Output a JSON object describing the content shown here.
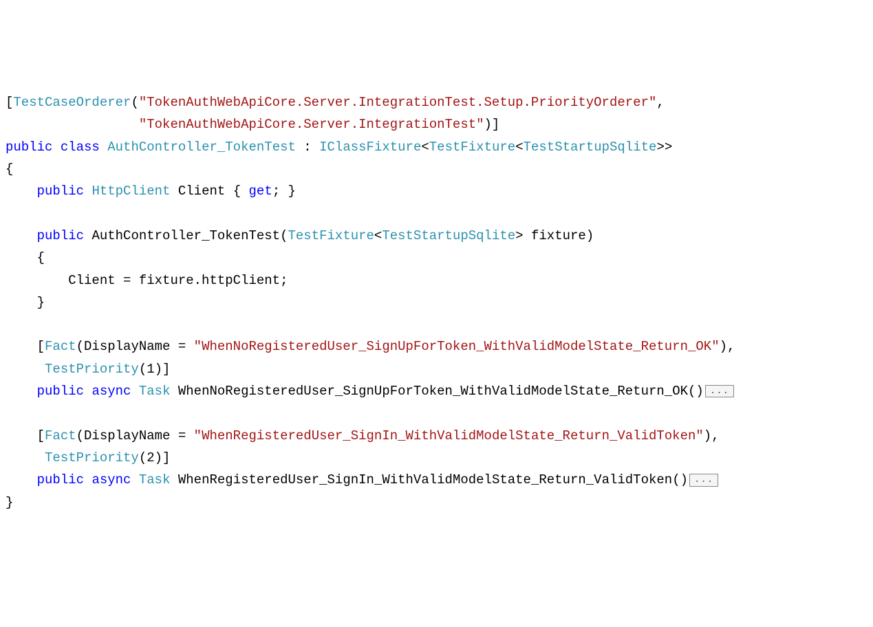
{
  "code": {
    "attr1_name": "TestCaseOrderer",
    "attr1_arg1": "\"TokenAuthWebApiCore.Server.IntegrationTest.Setup.PriorityOrderer\"",
    "attr1_arg2": "\"TokenAuthWebApiCore.Server.IntegrationTest\"",
    "kw_public": "public",
    "kw_class": "class",
    "class_name": "AuthController_TokenTest",
    "iface": "IClassFixture",
    "fixture_type": "TestFixture",
    "startup_type": "TestStartupSqlite",
    "http_client": "HttpClient",
    "client_prop": "Client",
    "kw_get": "get",
    "ctor_param": "fixture",
    "ctor_body": "Client = fixture.httpClient;",
    "fact_attr": "Fact",
    "display_name_prop": "DisplayName",
    "test_priority": "TestPriority",
    "priority1": "1",
    "priority2": "2",
    "kw_async": "async",
    "task_type": "Task",
    "test1_display": "\"WhenNoRegisteredUser_SignUpForToken_WithValidModelState_Return_OK\"",
    "test1_method": "WhenNoRegisteredUser_SignUpForToken_WithValidModelState_Return_OK",
    "test2_display": "\"WhenRegisteredUser_SignIn_WithValidModelState_Return_ValidToken\"",
    "test2_method": "WhenRegisteredUser_SignIn_WithValidModelState_Return_ValidToken",
    "fold_ellipsis": "..."
  }
}
